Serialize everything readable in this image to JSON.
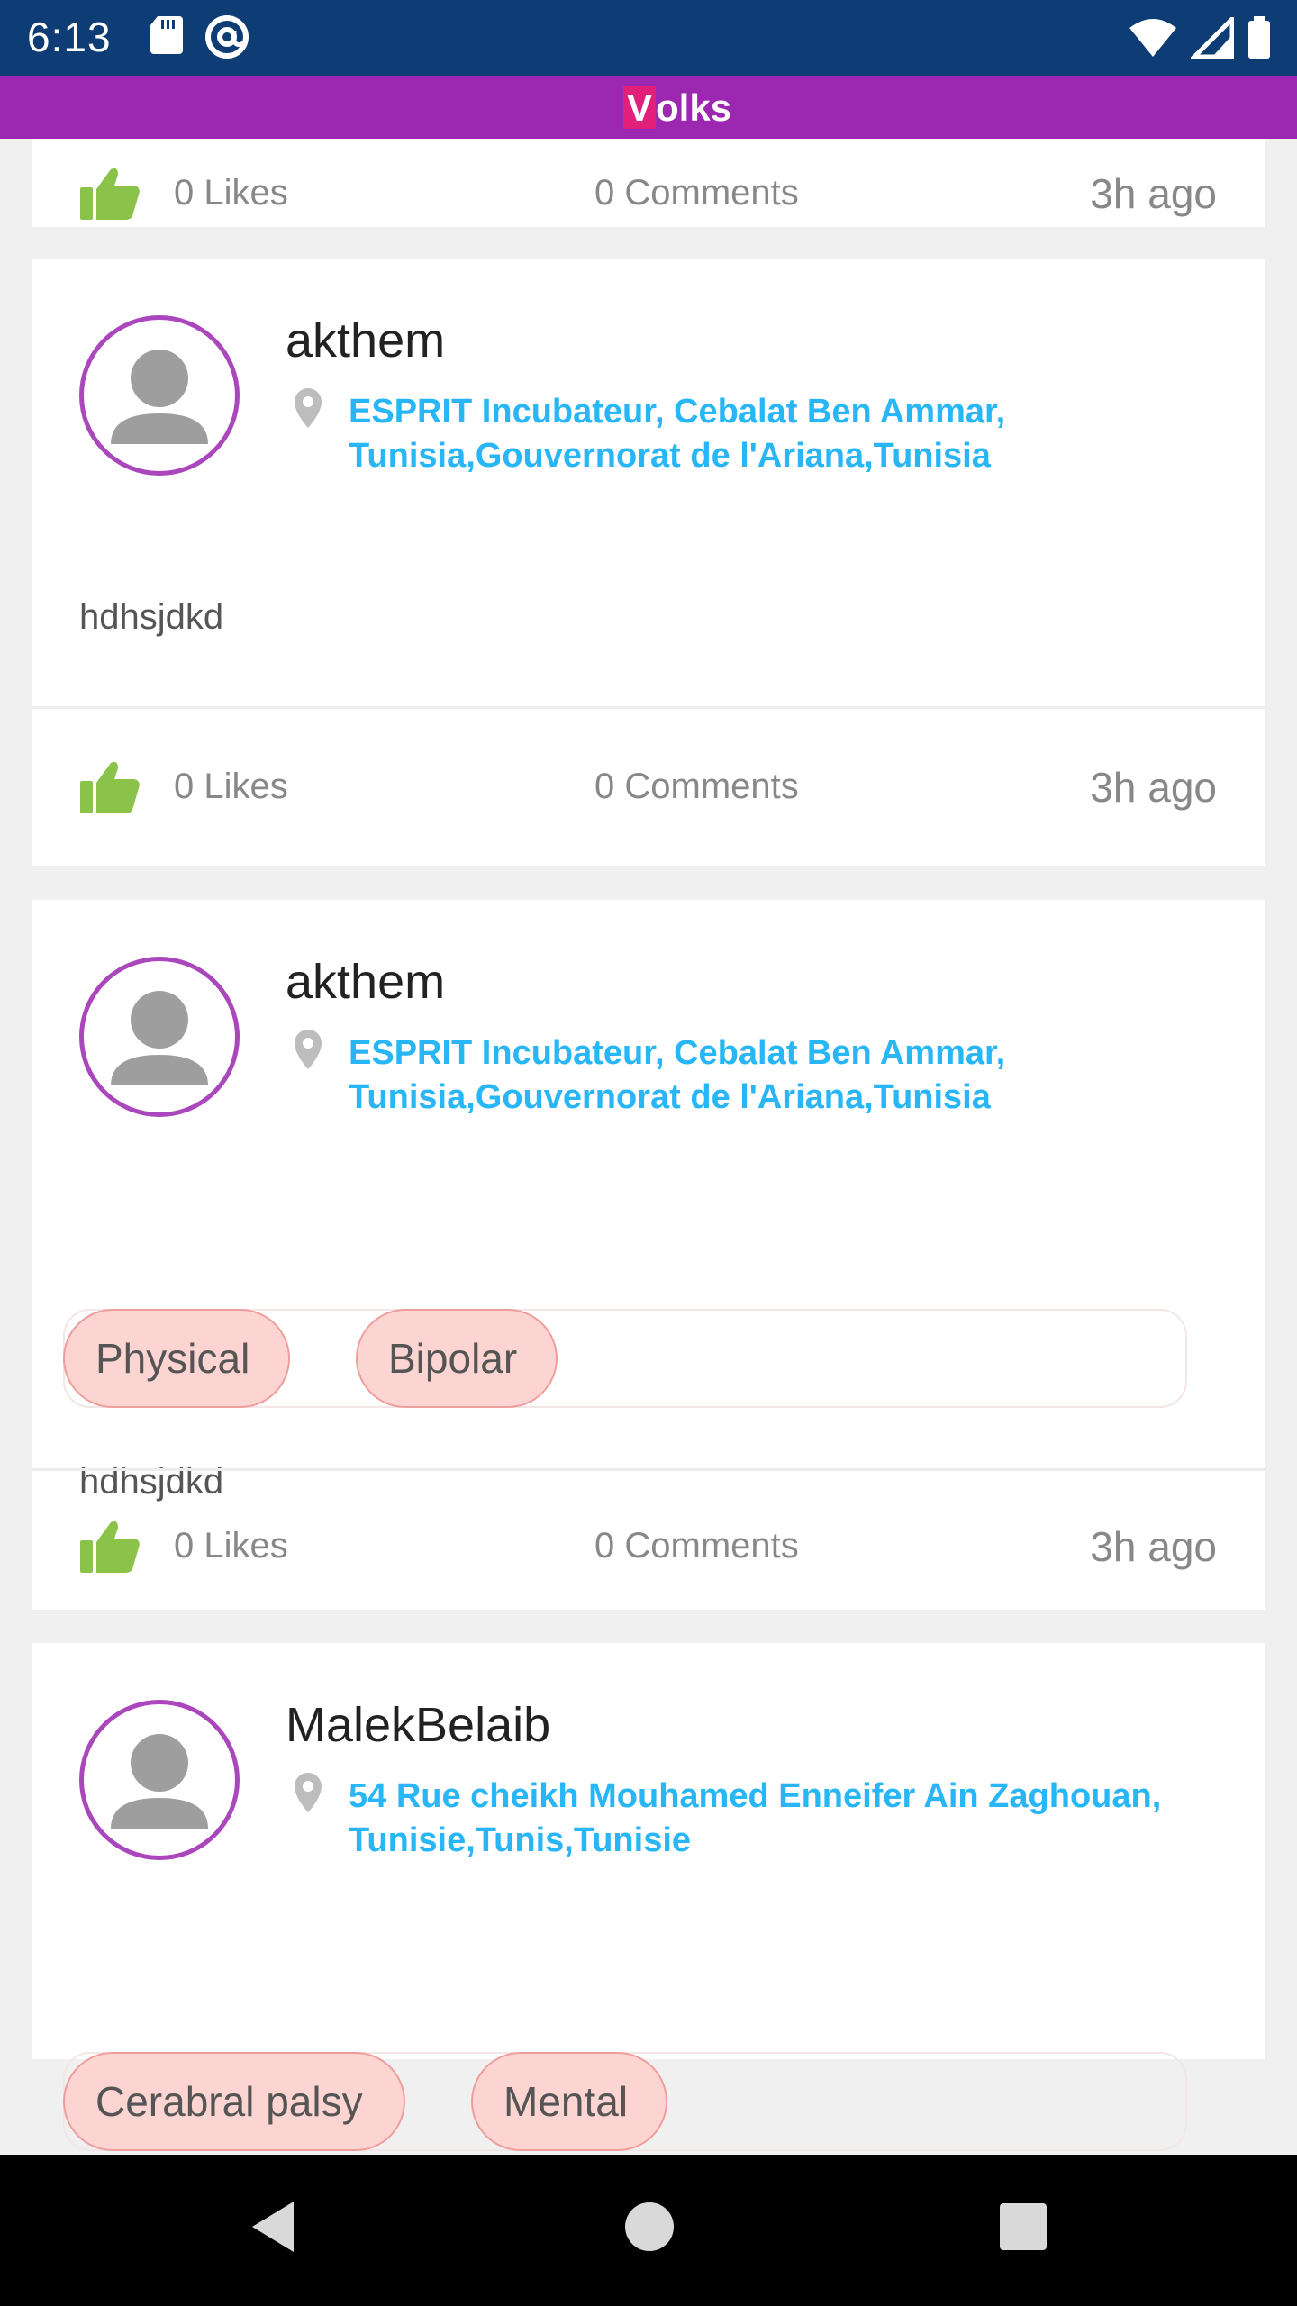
{
  "status_bar": {
    "time": "6:13",
    "left_icons": [
      "sd-card-icon",
      "at-sign-icon"
    ],
    "right_icons": [
      "wifi-icon",
      "signal-icon",
      "battery-icon"
    ]
  },
  "app": {
    "logo_first": "V",
    "logo_rest": "olks",
    "accent": "#9c27b0",
    "link_color": "#29b6f6"
  },
  "posts": [
    {
      "likes": "0 Likes",
      "comments": "0 Comments",
      "time": "3h ago"
    },
    {
      "user": "akthem",
      "location_line1": "ESPRIT Incubateur, Cebalat Ben Ammar,",
      "location_line2": "Tunisia,Gouvernorat de l'Ariana,Tunisia",
      "text": "hdhsjdkd",
      "likes": "0 Likes",
      "comments": "0 Comments",
      "time": "3h ago"
    },
    {
      "user": "akthem",
      "location_line1": "ESPRIT Incubateur, Cebalat Ben Ammar,",
      "location_line2": "Tunisia,Gouvernorat de l'Ariana,Tunisia",
      "tags": [
        "Physical",
        "Bipolar"
      ],
      "text": "hdhsjdkd",
      "likes": "0 Likes",
      "comments": "0 Comments",
      "time": "3h ago"
    },
    {
      "user": "MalekBelaib",
      "location_line1": "54 Rue cheikh Mouhamed Enneifer Ain Zaghouan,",
      "location_line2": "Tunisie,Tunis,Tunisie",
      "tags": [
        "Cerabral palsy",
        "Mental"
      ]
    }
  ],
  "nav": [
    "back-icon",
    "home-icon",
    "recents-icon"
  ]
}
